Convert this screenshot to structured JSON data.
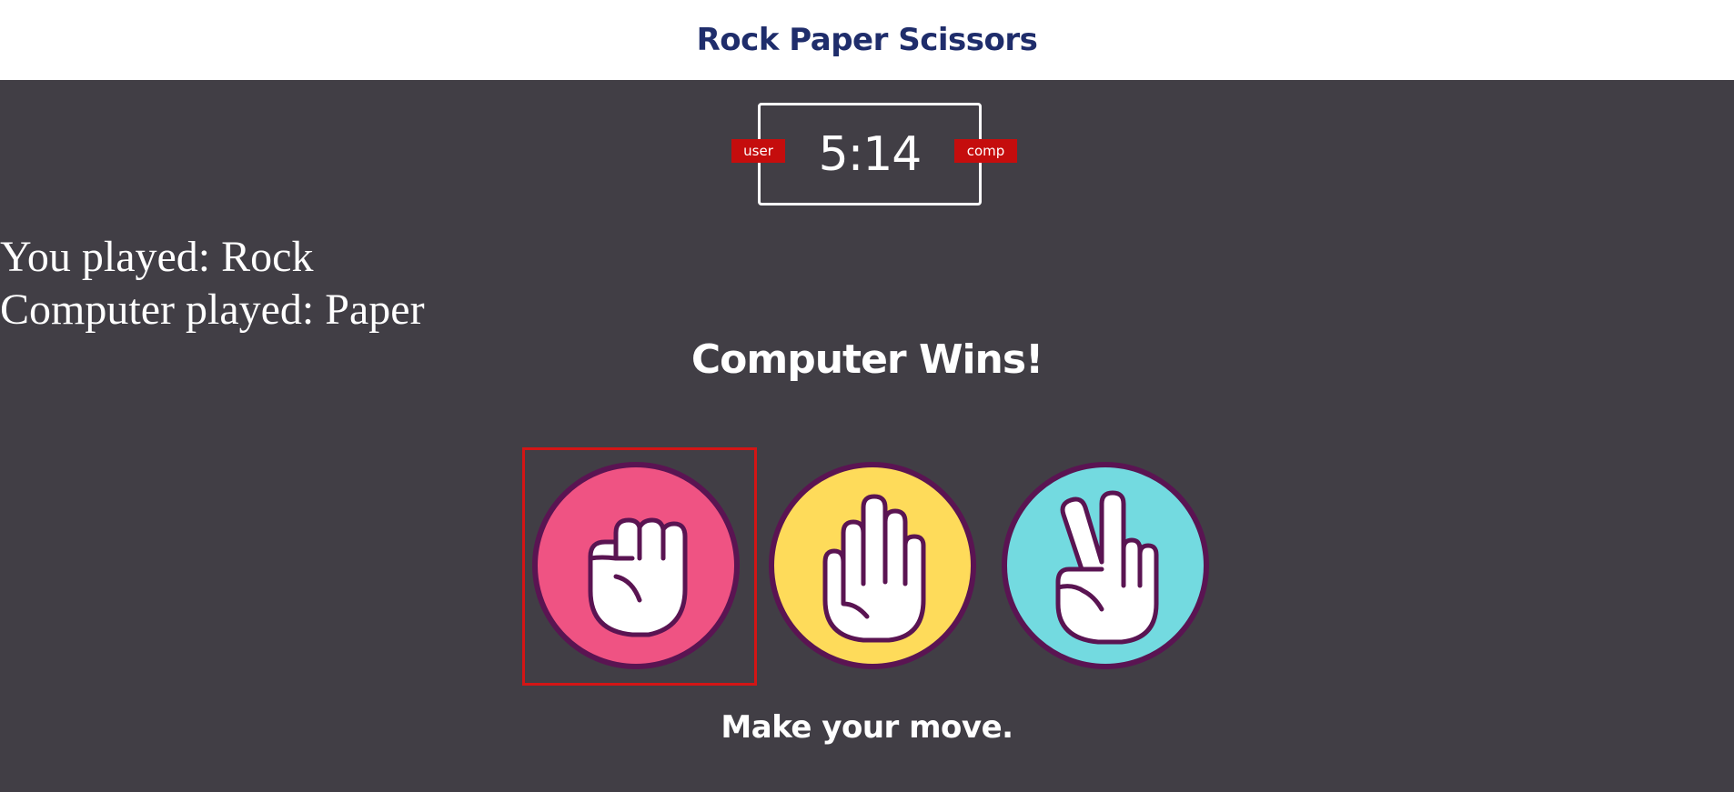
{
  "header": {
    "title": "Rock Paper Scissors"
  },
  "scoreboard": {
    "score": "5:14",
    "user_label": "user",
    "comp_label": "comp"
  },
  "round": {
    "you_played": "You played: Rock",
    "computer_played": "Computer played: Paper",
    "result": "Computer Wins!"
  },
  "choices": [
    {
      "name": "rock",
      "icon": "fist-hand-icon",
      "color": "#ef5383",
      "selected": true
    },
    {
      "name": "paper",
      "icon": "open-hand-icon",
      "color": "#fedb5a",
      "selected": false
    },
    {
      "name": "scissors",
      "icon": "peace-hand-icon",
      "color": "#73dae0",
      "selected": false
    }
  ],
  "prompt": {
    "message": "Make your move."
  },
  "colors": {
    "header_bg": "#ffffff",
    "title": "#1f2d6b",
    "page_bg": "#413e45",
    "badge": "#c50d0d",
    "selection_frame": "#d31515",
    "icon_outline": "#5a1452"
  }
}
